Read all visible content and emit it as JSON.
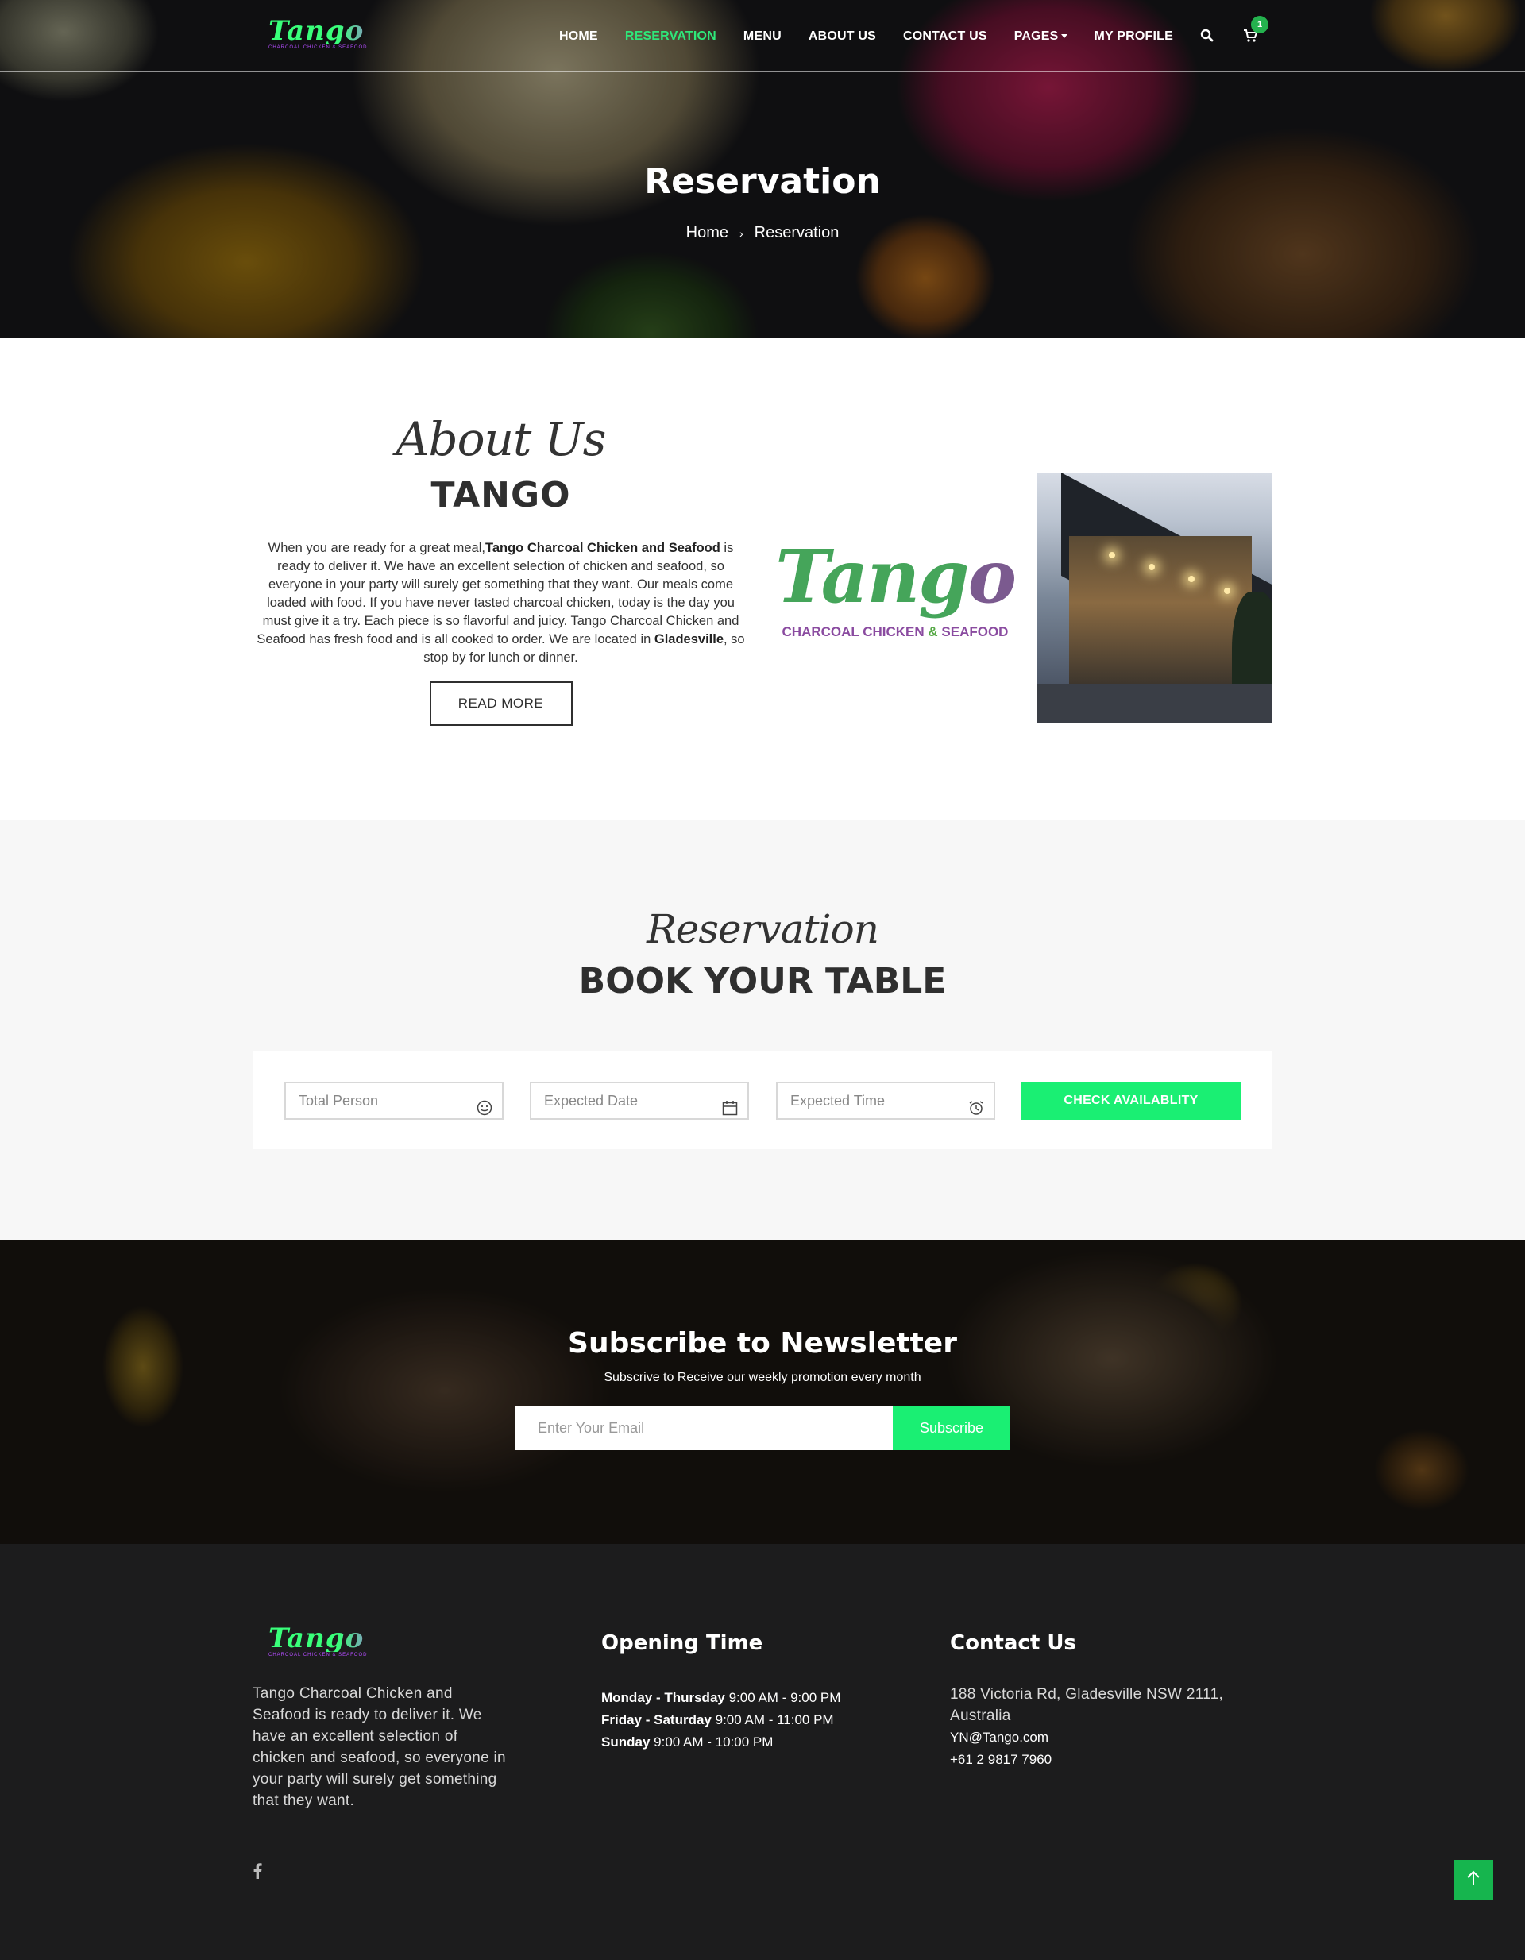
{
  "header": {
    "logo_text": "Tango",
    "logo_tagline": "CHARCOAL CHICKEN & SEAFOOD",
    "nav": [
      {
        "label": "HOME"
      },
      {
        "label": "RESERVATION"
      },
      {
        "label": "MENU"
      },
      {
        "label": "ABOUT US"
      },
      {
        "label": "CONTACT US"
      },
      {
        "label": "PAGES"
      },
      {
        "label": "MY PROFILE"
      }
    ],
    "active_nav": "RESERVATION",
    "cart_count": "1",
    "icons": [
      "search-icon",
      "cart-icon"
    ]
  },
  "hero": {
    "title": "Reservation",
    "breadcrumb": [
      "Home",
      "Reservation"
    ],
    "breadcrumb_separator": "›"
  },
  "about": {
    "script_title": "About Us",
    "heading": "TANGO",
    "text_intro": "When you are ready for a great meal,",
    "text_brand": "Tango Charcoal Chicken and Seafood",
    "text_middle": " is ready to deliver it. We have an excellent selection of chicken and seafood, so everyone in your party will surely get something that they want. Our meals come loaded with food. If you have never tasted charcoal chicken, today is the day you must give it a try. Each piece is so flavorful and juicy. Tango Charcoal Chicken and Seafood has fresh food and is all cooked to order. We are located in ",
    "text_location": "Gladesville",
    "text_end": ", so stop by for lunch or dinner.",
    "read_more": "READ MORE",
    "logo_image_word": "Tango",
    "logo_image_sub": "CHARCOAL CHICKEN & SEAFOOD"
  },
  "reservation": {
    "script_title": "Reservation",
    "heading": "BOOK YOUR TABLE",
    "fields": [
      {
        "placeholder": "Total Person",
        "icon": "smiley-icon"
      },
      {
        "placeholder": "Expected Date",
        "icon": "calendar-icon"
      },
      {
        "placeholder": "Expected Time",
        "icon": "alarm-clock-icon"
      }
    ],
    "check_button": "CHECK AVAILABLITY"
  },
  "newsletter": {
    "title": "Subscribe to Newsletter",
    "subtitle": "Subscrive to Receive our weekly promotion every month",
    "email_placeholder": "Enter Your Email",
    "subscribe_button": "Subscribe"
  },
  "footer": {
    "logo_text": "Tango",
    "logo_tagline": "CHARCOAL CHICKEN & SEAFOOD",
    "about_text": "Tango Charcoal Chicken and Seafood is ready to deliver it. We have an excellent selection of chicken and seafood, so everyone in your party will surely get something that they want.",
    "social": [
      "facebook-icon"
    ],
    "opening_title": "Opening Time",
    "hours": [
      {
        "days": "Monday - Thursday",
        "time": "9:00 AM - 9:00 PM"
      },
      {
        "days": "Friday - Saturday",
        "time": " 9:00 AM - 11:00 PM"
      },
      {
        "days": "Sunday",
        "time": "9:00 AM - 10:00 PM"
      }
    ],
    "contact_title": "Contact Us",
    "address": "188 Victoria Rd, Gladesville NSW 2111, Australia",
    "email": "YN@Tango.com",
    "phone": "+61 2 9817 7960"
  },
  "colors": {
    "accent": "#1aef73",
    "active_nav": "#2ee87a",
    "footer_bg": "#1c1c1d",
    "reservation_bg": "#f7f7f7",
    "to_top": "#16b54e"
  }
}
